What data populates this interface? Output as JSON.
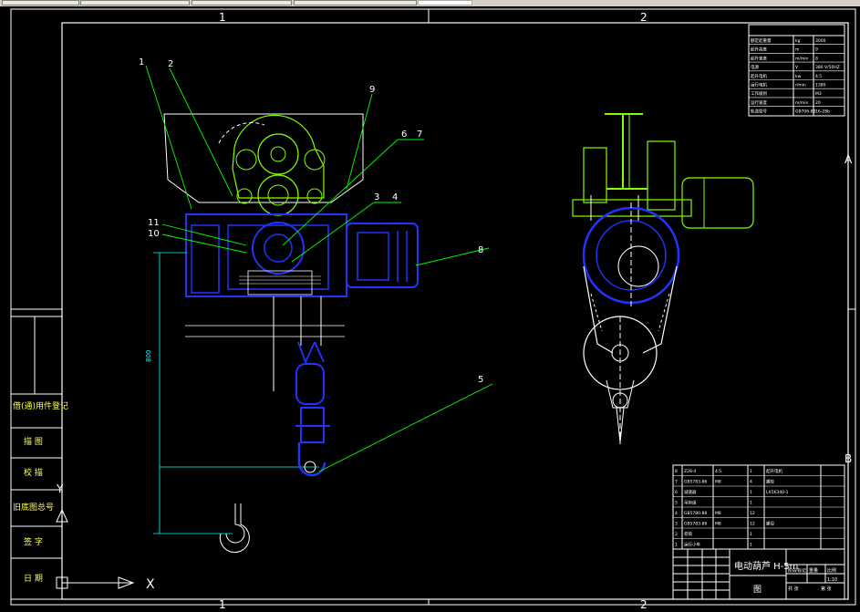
{
  "viewport": {
    "title": "CAD drawing viewport"
  },
  "colors": {
    "background": "#000000",
    "frame": "#ffffff",
    "titleblock": "#00ff66",
    "leaders": "#00ff00",
    "blue_parts": "#2233ff",
    "dimension": "#00ffff",
    "sidebar_text": "#ffff66"
  },
  "zone_marks": {
    "col1": "1",
    "col2": "2",
    "rowA": "A",
    "rowB": "B"
  },
  "balloons": [
    "1",
    "2",
    "9",
    "6",
    "7",
    "3",
    "4",
    "11",
    "10",
    "8",
    "5"
  ],
  "dimension": {
    "vertical_value": "800"
  },
  "sidebar": {
    "items": [
      "借(通)用件登记",
      "描 图",
      "校 描",
      "旧底图总号",
      "签 字",
      "日 期"
    ]
  },
  "ucs": {
    "x_label": "X",
    "y_label": "Y"
  },
  "tech_table": {
    "rows": [
      [
        "额定起重量",
        "kg",
        "3000"
      ],
      [
        "起升高度",
        "m",
        "9"
      ],
      [
        "起升速度",
        "m/min",
        "8"
      ],
      [
        "电源",
        "V",
        "380 V/50HZ"
      ],
      [
        "起升电机",
        "kw",
        "4.5"
      ],
      [
        "运行电机",
        "r/min",
        "1380"
      ],
      [
        "工作级别",
        "",
        "M3"
      ],
      [
        "运行速度",
        "m/min",
        "20"
      ],
      [
        "轨道型号",
        "GB706-88",
        "16-28b"
      ]
    ]
  },
  "parts_list": {
    "rows": [
      [
        "8",
        "Z28-4",
        "4.5",
        "1",
        "起升电机"
      ],
      [
        "7",
        "GB5783-86",
        "M8",
        "4",
        "螺栓"
      ],
      [
        "6",
        "减速器",
        "",
        "1",
        "LX5K340-1"
      ],
      [
        "5",
        "吊钩组",
        "",
        "1",
        ""
      ],
      [
        "4",
        "GB5780-86",
        "M8",
        "12",
        ""
      ],
      [
        "3",
        "GB5783-86",
        "M8",
        "12",
        "螺母"
      ],
      [
        "2",
        "卷筒",
        "",
        "1",
        ""
      ],
      [
        "1",
        "运行小车",
        "",
        "1",
        ""
      ]
    ]
  },
  "title_block": {
    "name": "电动葫芦 H-5m",
    "sub": "图",
    "right_cells": [
      "阶段标记",
      "重量",
      "比例",
      "1:10",
      "共 张",
      "第 张"
    ]
  }
}
